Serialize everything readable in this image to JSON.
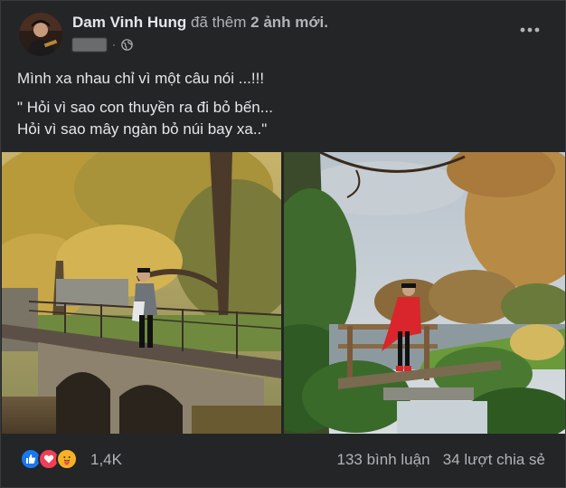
{
  "post": {
    "author": "Dam Vinh Hung",
    "action": "đã thêm",
    "count": "2 ảnh mới."
  },
  "caption": {
    "line1": "Mình xa nhau chỉ vì một câu nói ...!!!",
    "line2": "\" Hỏi vì sao con thuyền ra đi bỏ bến...",
    "line3": "Hỏi vì sao mây ngàn bỏ núi bay xa..\""
  },
  "footer": {
    "reaction_count": "1,4K",
    "comments": "133 bình luận",
    "shares": "34 lượt chia sẻ"
  },
  "icons": {
    "privacy": "globe-icon",
    "more": "more-horizontal-icon",
    "reactions": [
      "like-icon",
      "love-icon",
      "care-icon"
    ]
  },
  "colors": {
    "background": "#242526",
    "text_primary": "#e4e6eb",
    "text_secondary": "#b0b3b8",
    "like": "#1877f2",
    "love": "#f33e58",
    "care": "#f7b125"
  }
}
